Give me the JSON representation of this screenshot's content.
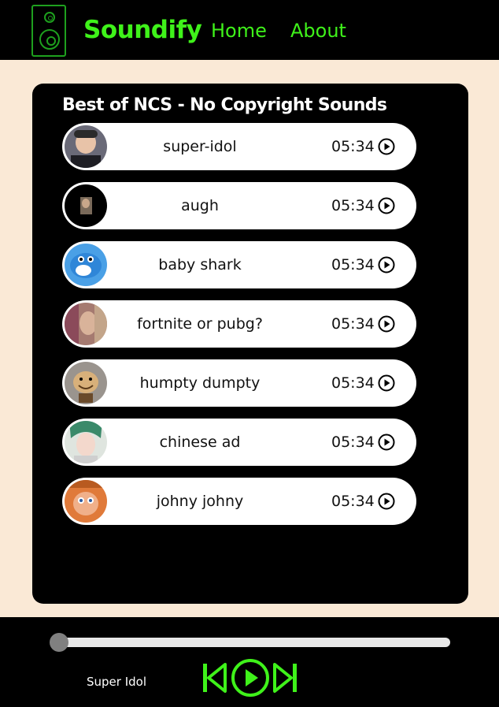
{
  "brand": {
    "name": "Soundify",
    "logo_icon": "speaker-icon",
    "color": "#3ff21a"
  },
  "nav": {
    "home": "Home",
    "about": "About"
  },
  "playlist": {
    "title": "Best of NCS - No Copyright Sounds",
    "songs": [
      {
        "name": "super-idol",
        "duration": "05:34",
        "thumb": "thumb-super-idol"
      },
      {
        "name": "augh",
        "duration": "05:34",
        "thumb": "thumb-augh"
      },
      {
        "name": "baby shark",
        "duration": "05:34",
        "thumb": "thumb-baby-shark"
      },
      {
        "name": "fortnite or pubg?",
        "duration": "05:34",
        "thumb": "thumb-fortnite"
      },
      {
        "name": "humpty dumpty",
        "duration": "05:34",
        "thumb": "thumb-humpty"
      },
      {
        "name": "chinese ad",
        "duration": "05:34",
        "thumb": "thumb-chinese-ad"
      },
      {
        "name": "johny johny",
        "duration": "05:34",
        "thumb": "thumb-johny"
      }
    ]
  },
  "player": {
    "now_playing": "Super Idol",
    "progress": 0,
    "controls": [
      "previous-icon",
      "play-icon",
      "next-icon"
    ]
  },
  "colors": {
    "accent": "#3ff21a",
    "page_bg": "#fae9d6",
    "panel_bg": "#000000"
  }
}
